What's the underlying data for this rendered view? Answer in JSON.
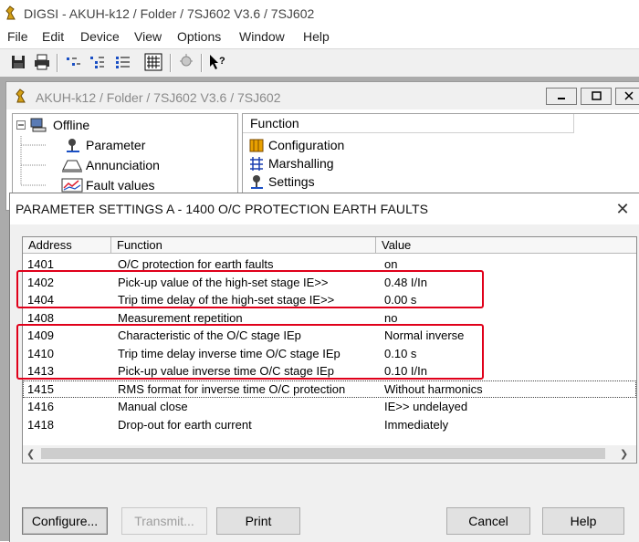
{
  "app": {
    "title": "DIGSI - AKUH-k12 / Folder / 7SJ602 V3.6 / 7SJ602",
    "menu": [
      "File",
      "Edit",
      "Device",
      "View",
      "Options",
      "Window",
      "Help"
    ],
    "toolbar_icons": [
      "save-icon",
      "print-icon",
      "view-list-icon",
      "view-tree-icon",
      "view-details-icon",
      "view-grid-icon",
      "device-icon",
      "help-pointer-icon"
    ]
  },
  "mdi": {
    "title": "AKUH-k12 / Folder / 7SJ602 V3.6 / 7SJ602",
    "tree": [
      {
        "label": "Offline",
        "icon": "computer-icon"
      },
      {
        "label": "Parameter",
        "icon": "parameter-icon"
      },
      {
        "label": "Annunciation",
        "icon": "annunciation-icon"
      },
      {
        "label": "Fault values",
        "icon": "fault-values-icon"
      }
    ],
    "function_header": "Function",
    "functions": [
      {
        "label": "Configuration",
        "icon": "configuration-icon"
      },
      {
        "label": "Marshalling",
        "icon": "marshalling-icon"
      },
      {
        "label": "Settings",
        "icon": "settings-icon"
      }
    ]
  },
  "dialog": {
    "title": "PARAMETER SETTINGS A - 1400  O/C PROTECTION EARTH FAULTS",
    "close_label": "✕",
    "columns": [
      "Address",
      "Function",
      "Value"
    ],
    "rows": [
      {
        "address": "1401",
        "function": "O/C protection for earth faults",
        "value": "on"
      },
      {
        "address": "1402",
        "function": "Pick-up value of the high-set stage IE>>",
        "value": "0.48 I/In"
      },
      {
        "address": "1404",
        "function": "Trip time delay of the high-set stage IE>>",
        "value": "0.00 s"
      },
      {
        "address": "1408",
        "function": "Measurement repetition",
        "value": "no"
      },
      {
        "address": "1409",
        "function": "Characteristic of the O/C stage IEp",
        "value": "Normal inverse"
      },
      {
        "address": "1410",
        "function": "Trip time delay inverse time O/C stage IEp",
        "value": "0.10 s"
      },
      {
        "address": "1413",
        "function": "Pick-up value inverse time O/C stage IEp",
        "value": "0.10 I/In"
      },
      {
        "address": "1415",
        "function": "RMS format for inverse time O/C protection",
        "value": "Without harmonics"
      },
      {
        "address": "1416",
        "function": "Manual close",
        "value": "IE>> undelayed"
      },
      {
        "address": "1418",
        "function": "Drop-out for earth current",
        "value": "Immediately"
      }
    ],
    "buttons": {
      "configure": "Configure...",
      "transmit": "Transmit...",
      "print": "Print",
      "cancel": "Cancel",
      "help": "Help"
    },
    "highlight_color": "#e0001a"
  }
}
